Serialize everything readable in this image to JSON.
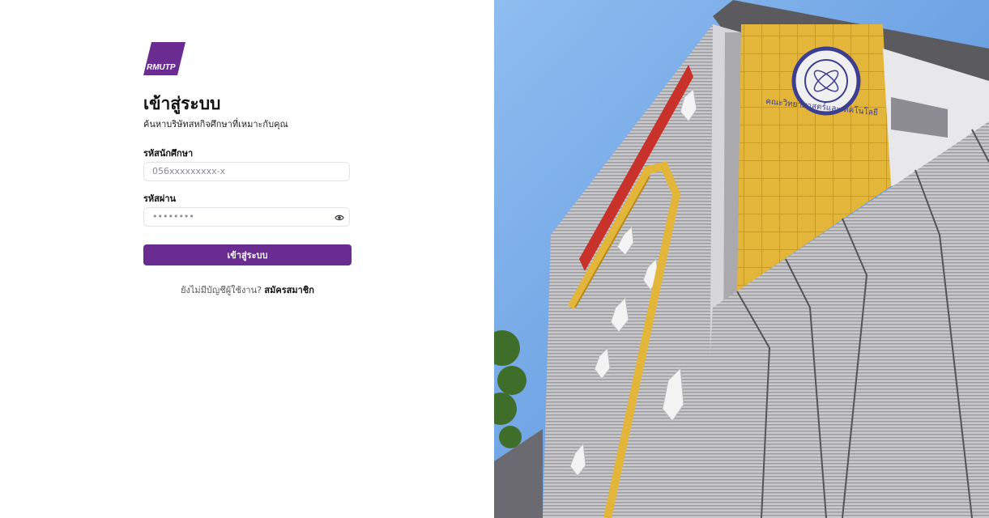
{
  "brand": {
    "logo_text": "RMUTP",
    "logo_color": "#6b2c91"
  },
  "login": {
    "title": "เข้าสู่ระบบ",
    "subtitle": "ค้นหาบริษัทสหกิจศึกษาที่เหมาะกับคุณ",
    "student_id_label": "รหัสนักศึกษา",
    "student_id_placeholder": "056xxxxxxxxx-x",
    "password_label": "รหัสผ่าน",
    "password_placeholder": "••••••••",
    "submit_label": "เข้าสู่ระบบ",
    "no_account_text": "ยังไม่มีบัญชีผู้ใช้งาน?",
    "signup_link": "สมัครสมาชิก"
  },
  "hero_image": {
    "building_sign": "คณะวิทยาศาสตร์และเทคโนโลยี",
    "sky_color": "#7fb2ea",
    "accent_color": "#e3b63a"
  }
}
